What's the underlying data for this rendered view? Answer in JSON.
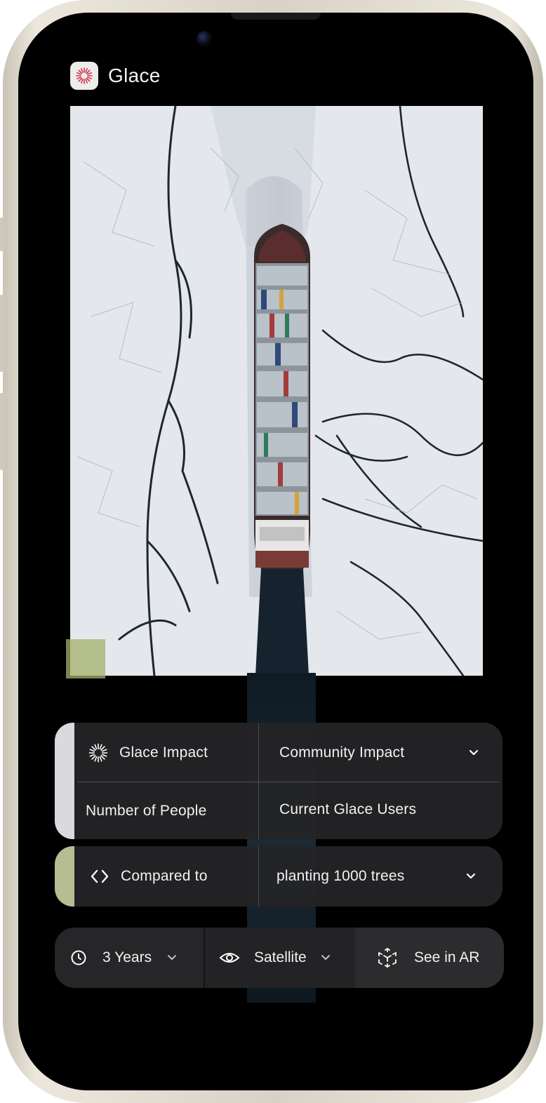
{
  "app": {
    "name": "Glace",
    "logo_icon": "sunburst-icon"
  },
  "hero": {
    "description_icon": "satellite-photo"
  },
  "impact_panel": {
    "row1": {
      "left_label": "Glace Impact",
      "left_icon": "sunburst-icon",
      "right_value": "Community Impact"
    },
    "row2": {
      "left_label": "Number of People",
      "right_value": "Current Glace Users"
    }
  },
  "compare_panel": {
    "left_label": "Compared to",
    "left_icon": "code-brackets-icon",
    "right_value": "planting 1000 trees"
  },
  "toolbar": {
    "timeframe": {
      "label": "3 Years",
      "icon": "clock-icon"
    },
    "view": {
      "label": "Satellite",
      "icon": "eye-icon"
    },
    "ar": {
      "label": "See in AR",
      "icon": "ar-cube-icon"
    }
  },
  "colors": {
    "background": "#000000",
    "panel": "#242426",
    "accent_white": "#d9d9de",
    "accent_olive": "#b6bd92",
    "marker": "#a4b06a"
  }
}
